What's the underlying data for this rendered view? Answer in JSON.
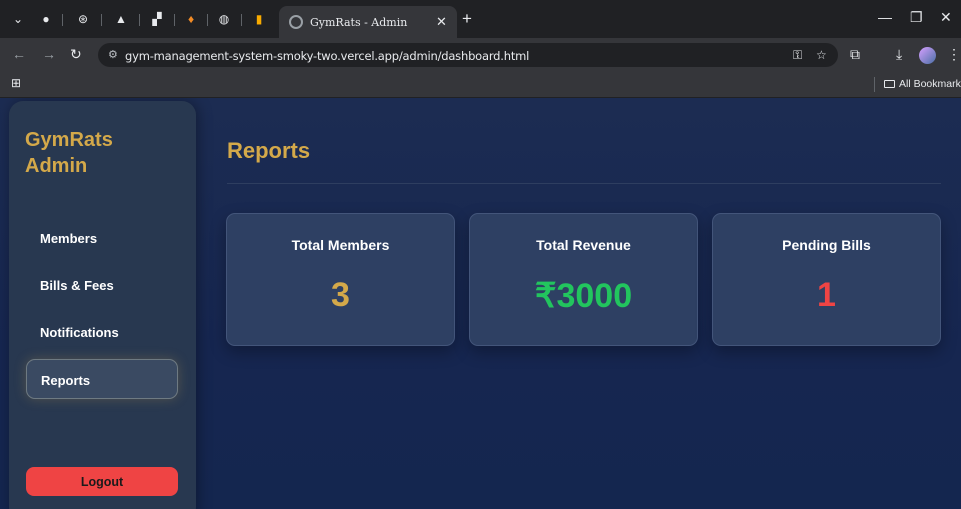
{
  "browser": {
    "tab_title": "GymRats - Admin",
    "url": "gym-management-system-smoky-two.vercel.app/admin/dashboard.html",
    "bookmarks_label": "All Bookmarks"
  },
  "sidebar": {
    "brand_line1": "GymRats",
    "brand_line2": "Admin",
    "items": [
      {
        "label": "Members"
      },
      {
        "label": "Bills & Fees"
      },
      {
        "label": "Notifications"
      },
      {
        "label": "Reports"
      }
    ],
    "active_item": "Reports",
    "logout_label": "Logout"
  },
  "main": {
    "title": "Reports",
    "cards": [
      {
        "label": "Total Members",
        "value": "3",
        "color": "#d4a94a"
      },
      {
        "label": "Total Revenue",
        "value": "₹3000",
        "color": "#22c55e"
      },
      {
        "label": "Pending Bills",
        "value": "1",
        "color": "#ef4444"
      }
    ]
  },
  "colors": {
    "accent": "#d4a94a",
    "logout": "#ef4444",
    "page_bg": "#1c2c52",
    "sidebar_bg": "#283850"
  }
}
